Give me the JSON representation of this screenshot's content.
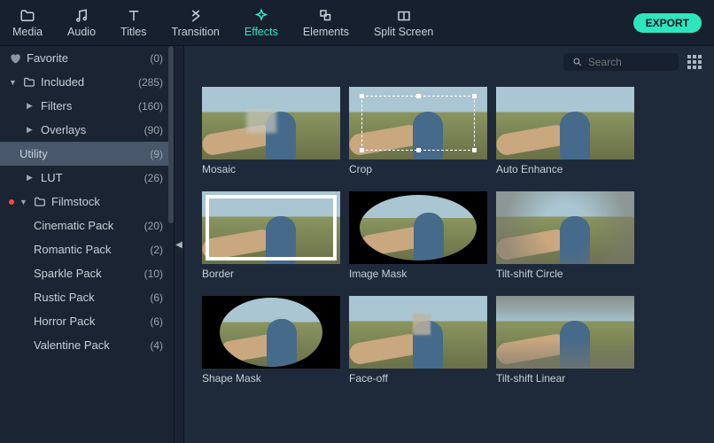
{
  "topbar": {
    "tabs": [
      {
        "label": "Media",
        "icon": "folder-icon"
      },
      {
        "label": "Audio",
        "icon": "music-icon"
      },
      {
        "label": "Titles",
        "icon": "text-icon"
      },
      {
        "label": "Transition",
        "icon": "transition-icon"
      },
      {
        "label": "Effects",
        "icon": "sparkle-icon"
      },
      {
        "label": "Elements",
        "icon": "shapes-icon"
      },
      {
        "label": "Split Screen",
        "icon": "split-icon"
      }
    ],
    "active_tab": "Effects",
    "export_label": "EXPORT"
  },
  "search": {
    "placeholder": "Search"
  },
  "sidebar": {
    "favorite": {
      "label": "Favorite",
      "count": "(0)"
    },
    "included": {
      "label": "Included",
      "count": "(285)"
    },
    "filters": {
      "label": "Filters",
      "count": "(160)"
    },
    "overlays": {
      "label": "Overlays",
      "count": "(90)"
    },
    "utility": {
      "label": "Utility",
      "count": "(9)"
    },
    "lut": {
      "label": "LUT",
      "count": "(26)"
    },
    "filmstock": {
      "label": "Filmstock",
      "count": ""
    },
    "packs": [
      {
        "label": "Cinematic Pack",
        "count": "(20)"
      },
      {
        "label": "Romantic Pack",
        "count": "(2)"
      },
      {
        "label": "Sparkle Pack",
        "count": "(10)"
      },
      {
        "label": "Rustic Pack",
        "count": "(6)"
      },
      {
        "label": "Horror Pack",
        "count": "(6)"
      },
      {
        "label": "Valentine Pack",
        "count": "(4)"
      }
    ]
  },
  "effects": [
    {
      "label": "Mosaic"
    },
    {
      "label": "Crop"
    },
    {
      "label": "Auto Enhance"
    },
    {
      "label": "Border"
    },
    {
      "label": "Image Mask"
    },
    {
      "label": "Tilt-shift Circle"
    },
    {
      "label": "Shape Mask"
    },
    {
      "label": "Face-off"
    },
    {
      "label": "Tilt-shift Linear"
    }
  ]
}
